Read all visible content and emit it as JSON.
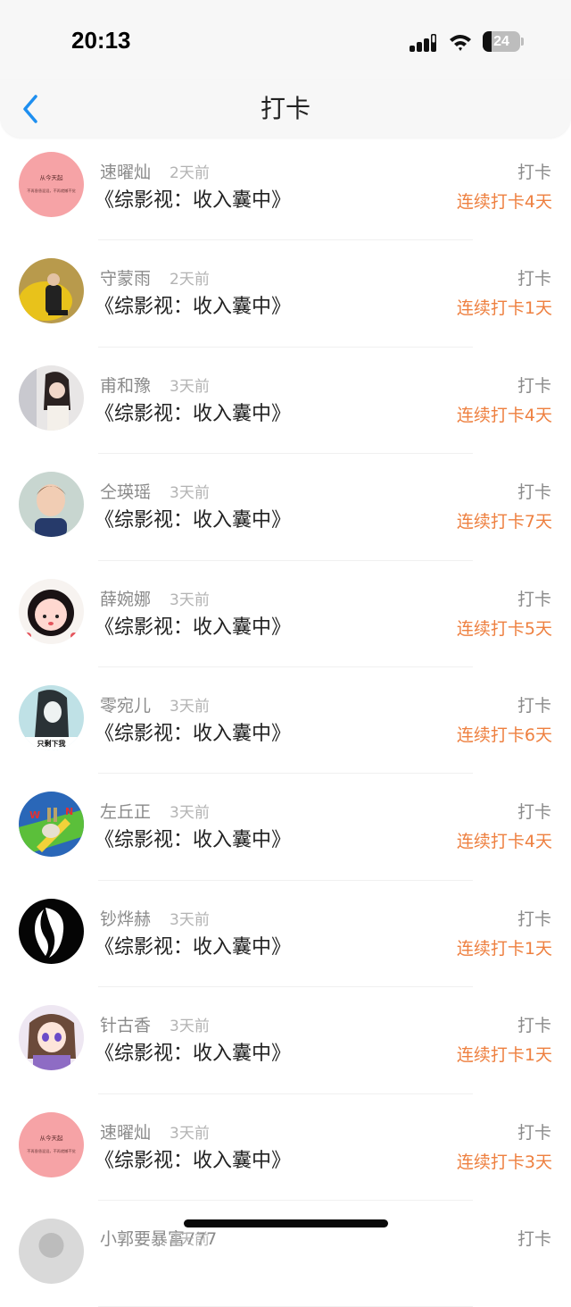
{
  "status_bar": {
    "time": "20:13",
    "battery_percent": "24",
    "battery_level": 0.24
  },
  "nav": {
    "title": "打卡",
    "back_icon": "chevron-left-icon"
  },
  "colors": {
    "accent": "#ee8040",
    "back_blue": "#1e8ff0"
  },
  "entries": [
    {
      "name": "速曜灿",
      "ago": "2天前",
      "book": "《综影视：收入囊中》",
      "type": "打卡",
      "streak": "连续打卡4天",
      "avatar": "pink-text-avatar",
      "avatar_texts": [
        "从今天起",
        "不再昏昏混混，不再就懒不觉"
      ]
    },
    {
      "name": "守蒙雨",
      "ago": "2天前",
      "book": "《综影视：收入囊中》",
      "type": "打卡",
      "streak": "连续打卡1天",
      "avatar": "yellow-sofa-avatar"
    },
    {
      "name": "甫和豫",
      "ago": "3天前",
      "book": "《综影视：收入囊中》",
      "type": "打卡",
      "streak": "连续打卡4天",
      "avatar": "girl-window-avatar"
    },
    {
      "name": "仝瑛瑶",
      "ago": "3天前",
      "book": "《综影视：收入囊中》",
      "type": "打卡",
      "streak": "连续打卡7天",
      "avatar": "boy-avatar"
    },
    {
      "name": "薛婉娜",
      "ago": "3天前",
      "book": "《综影视：收入囊中》",
      "type": "打卡",
      "streak": "连续打卡5天",
      "avatar": "cartoon-girl-avatar"
    },
    {
      "name": "零宛儿",
      "ago": "3天前",
      "book": "《综影视：收入囊中》",
      "type": "打卡",
      "streak": "连续打卡6天",
      "avatar": "blue-girl-avatar",
      "avatar_texts": [
        "只剩下我"
      ]
    },
    {
      "name": "左丘正",
      "ago": "3天前",
      "book": "《综影视：收入囊中》",
      "type": "打卡",
      "streak": "连续打卡4天",
      "avatar": "rabbit-cartoon-avatar",
      "avatar_texts": [
        "W",
        "N"
      ]
    },
    {
      "name": "钞烨赫",
      "ago": "3天前",
      "book": "《综影视：收入囊中》",
      "type": "打卡",
      "streak": "连续打卡1天",
      "avatar": "mask-avatar"
    },
    {
      "name": "针古香",
      "ago": "3天前",
      "book": "《综影视：收入囊中》",
      "type": "打卡",
      "streak": "连续打卡1天",
      "avatar": "anime-girl-avatar"
    },
    {
      "name": "速曜灿",
      "ago": "3天前",
      "book": "《综影视：收入囊中》",
      "type": "打卡",
      "streak": "连续打卡3天",
      "avatar": "pink-text-avatar",
      "avatar_texts": [
        "从今天起",
        "不再昏昏混混，不再就懒不觉"
      ]
    },
    {
      "name": "小郭要暴富777",
      "ago": "4天前",
      "book": "",
      "type": "打卡",
      "streak": "",
      "avatar": "partial-avatar"
    }
  ]
}
